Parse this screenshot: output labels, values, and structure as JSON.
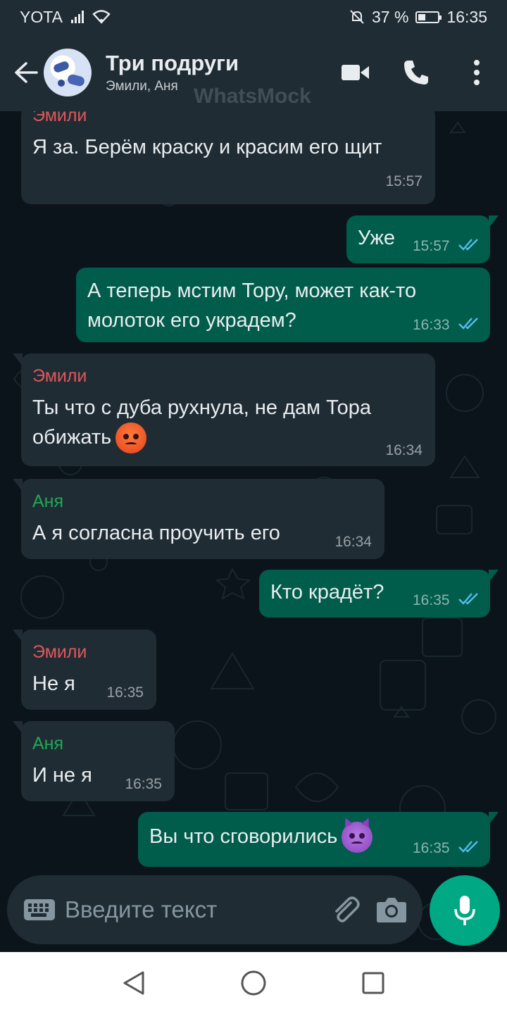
{
  "status_bar": {
    "carrier": "YOTA",
    "battery": "37 %",
    "battery_level": 0.37,
    "time": "16:35"
  },
  "header": {
    "title": "Три подруги",
    "subtitle": "Эмили, Аня",
    "watermark": "WhatsMock"
  },
  "colors": {
    "sender_emily": "#e1575a",
    "sender_anya": "#1fa855",
    "tick_read": "#53bdeb",
    "incoming_bubble": "#1f2c34",
    "outgoing_bubble": "#005c4b",
    "accent": "#00a884"
  },
  "messages": [
    {
      "sender": "Эмили",
      "text": "Я за. Берём краску и красим его щит",
      "time": "15:57"
    },
    {
      "text": "Уже",
      "time": "15:57"
    },
    {
      "text": "А теперь мстим Тору,  может как-то\nмолоток его украдем?",
      "time": "16:33"
    },
    {
      "sender": "Эмили",
      "text": "Ты что с дуба рухнула, не дам Тора\nобижать",
      "emoji": "angry-face",
      "time": "16:34"
    },
    {
      "sender": "Аня",
      "text": "А я согласна проучить его",
      "time": "16:34"
    },
    {
      "text": "Кто крадёт?",
      "time": "16:35"
    },
    {
      "sender": "Эмили",
      "text": "Не я",
      "time": "16:35"
    },
    {
      "sender": "Аня",
      "text": "И не я",
      "time": "16:35"
    },
    {
      "text": "Вы что сговорились",
      "emoji": "devil-face",
      "time": "16:35"
    }
  ],
  "composer": {
    "placeholder": "Введите текст"
  }
}
